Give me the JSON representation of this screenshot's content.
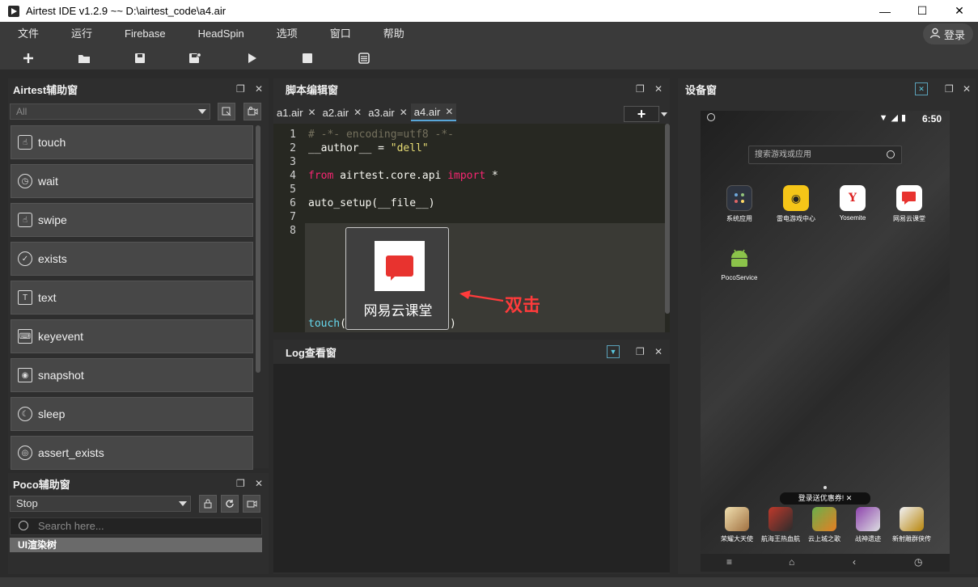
{
  "window": {
    "title": "Airtest IDE v1.2.9 ~~ D:\\airtest_code\\a4.air",
    "minimize": "—",
    "maximize": "☐",
    "close": "✕"
  },
  "menu": {
    "items": [
      "文件",
      "运行",
      "Firebase",
      "HeadSpin",
      "选项",
      "窗口",
      "帮助"
    ],
    "login_label": "登录"
  },
  "toolbar": {
    "new_icon": "plus-icon",
    "open_icon": "folder-icon",
    "save_icon": "save-icon",
    "save_as_icon": "save-as-icon",
    "run_icon": "play-icon",
    "stop_icon": "stop-icon",
    "log_icon": "list-icon"
  },
  "airtest_panel": {
    "title": "Airtest辅助窗",
    "filter_value": "All",
    "apis": [
      "touch",
      "wait",
      "swipe",
      "exists",
      "text",
      "keyevent",
      "snapshot",
      "sleep",
      "assert_exists"
    ]
  },
  "poco_panel": {
    "title": "Poco辅助窗",
    "mode_value": "Stop",
    "search_placeholder": "Search here...",
    "tree_root": "UI渲染树"
  },
  "editor": {
    "title": "脚本编辑窗",
    "tabs": [
      "a1.air",
      "a2.air",
      "a3.air",
      "a4.air"
    ],
    "active_tab": "a4.air",
    "line_numbers": [
      "1",
      "2",
      "3",
      "4",
      "5",
      "6",
      "7",
      "8"
    ],
    "code": {
      "l1": "# -*- encoding=utf8 -*-",
      "l2_var": "__author__ = ",
      "l2_str": "\"dell\"",
      "l4_from": "from",
      "l4_mod": " airtest.core.api ",
      "l4_import": "import",
      "l4_star": " *",
      "l6": "auto_setup(__file__)",
      "l8_fn": "touch",
      "l8_open": "(",
      "l8_close": ")"
    },
    "template_caption": "网易云课堂"
  },
  "annotation": {
    "text": "双击"
  },
  "log_panel": {
    "title": "Log查看窗"
  },
  "device_panel": {
    "title": "设备窗",
    "time": "6:50",
    "search_placeholder": "搜索游戏或应用",
    "apps": [
      "系统应用",
      "雷电游戏中心",
      "Yosemite",
      "网易云课堂",
      "PocoService"
    ],
    "promo": "登录送优惠券! ✕",
    "dock_apps": [
      "荣耀大天使",
      "航海王热血航",
      "云上城之歌",
      "战神遗迹",
      "新射雕群侠传"
    ]
  }
}
